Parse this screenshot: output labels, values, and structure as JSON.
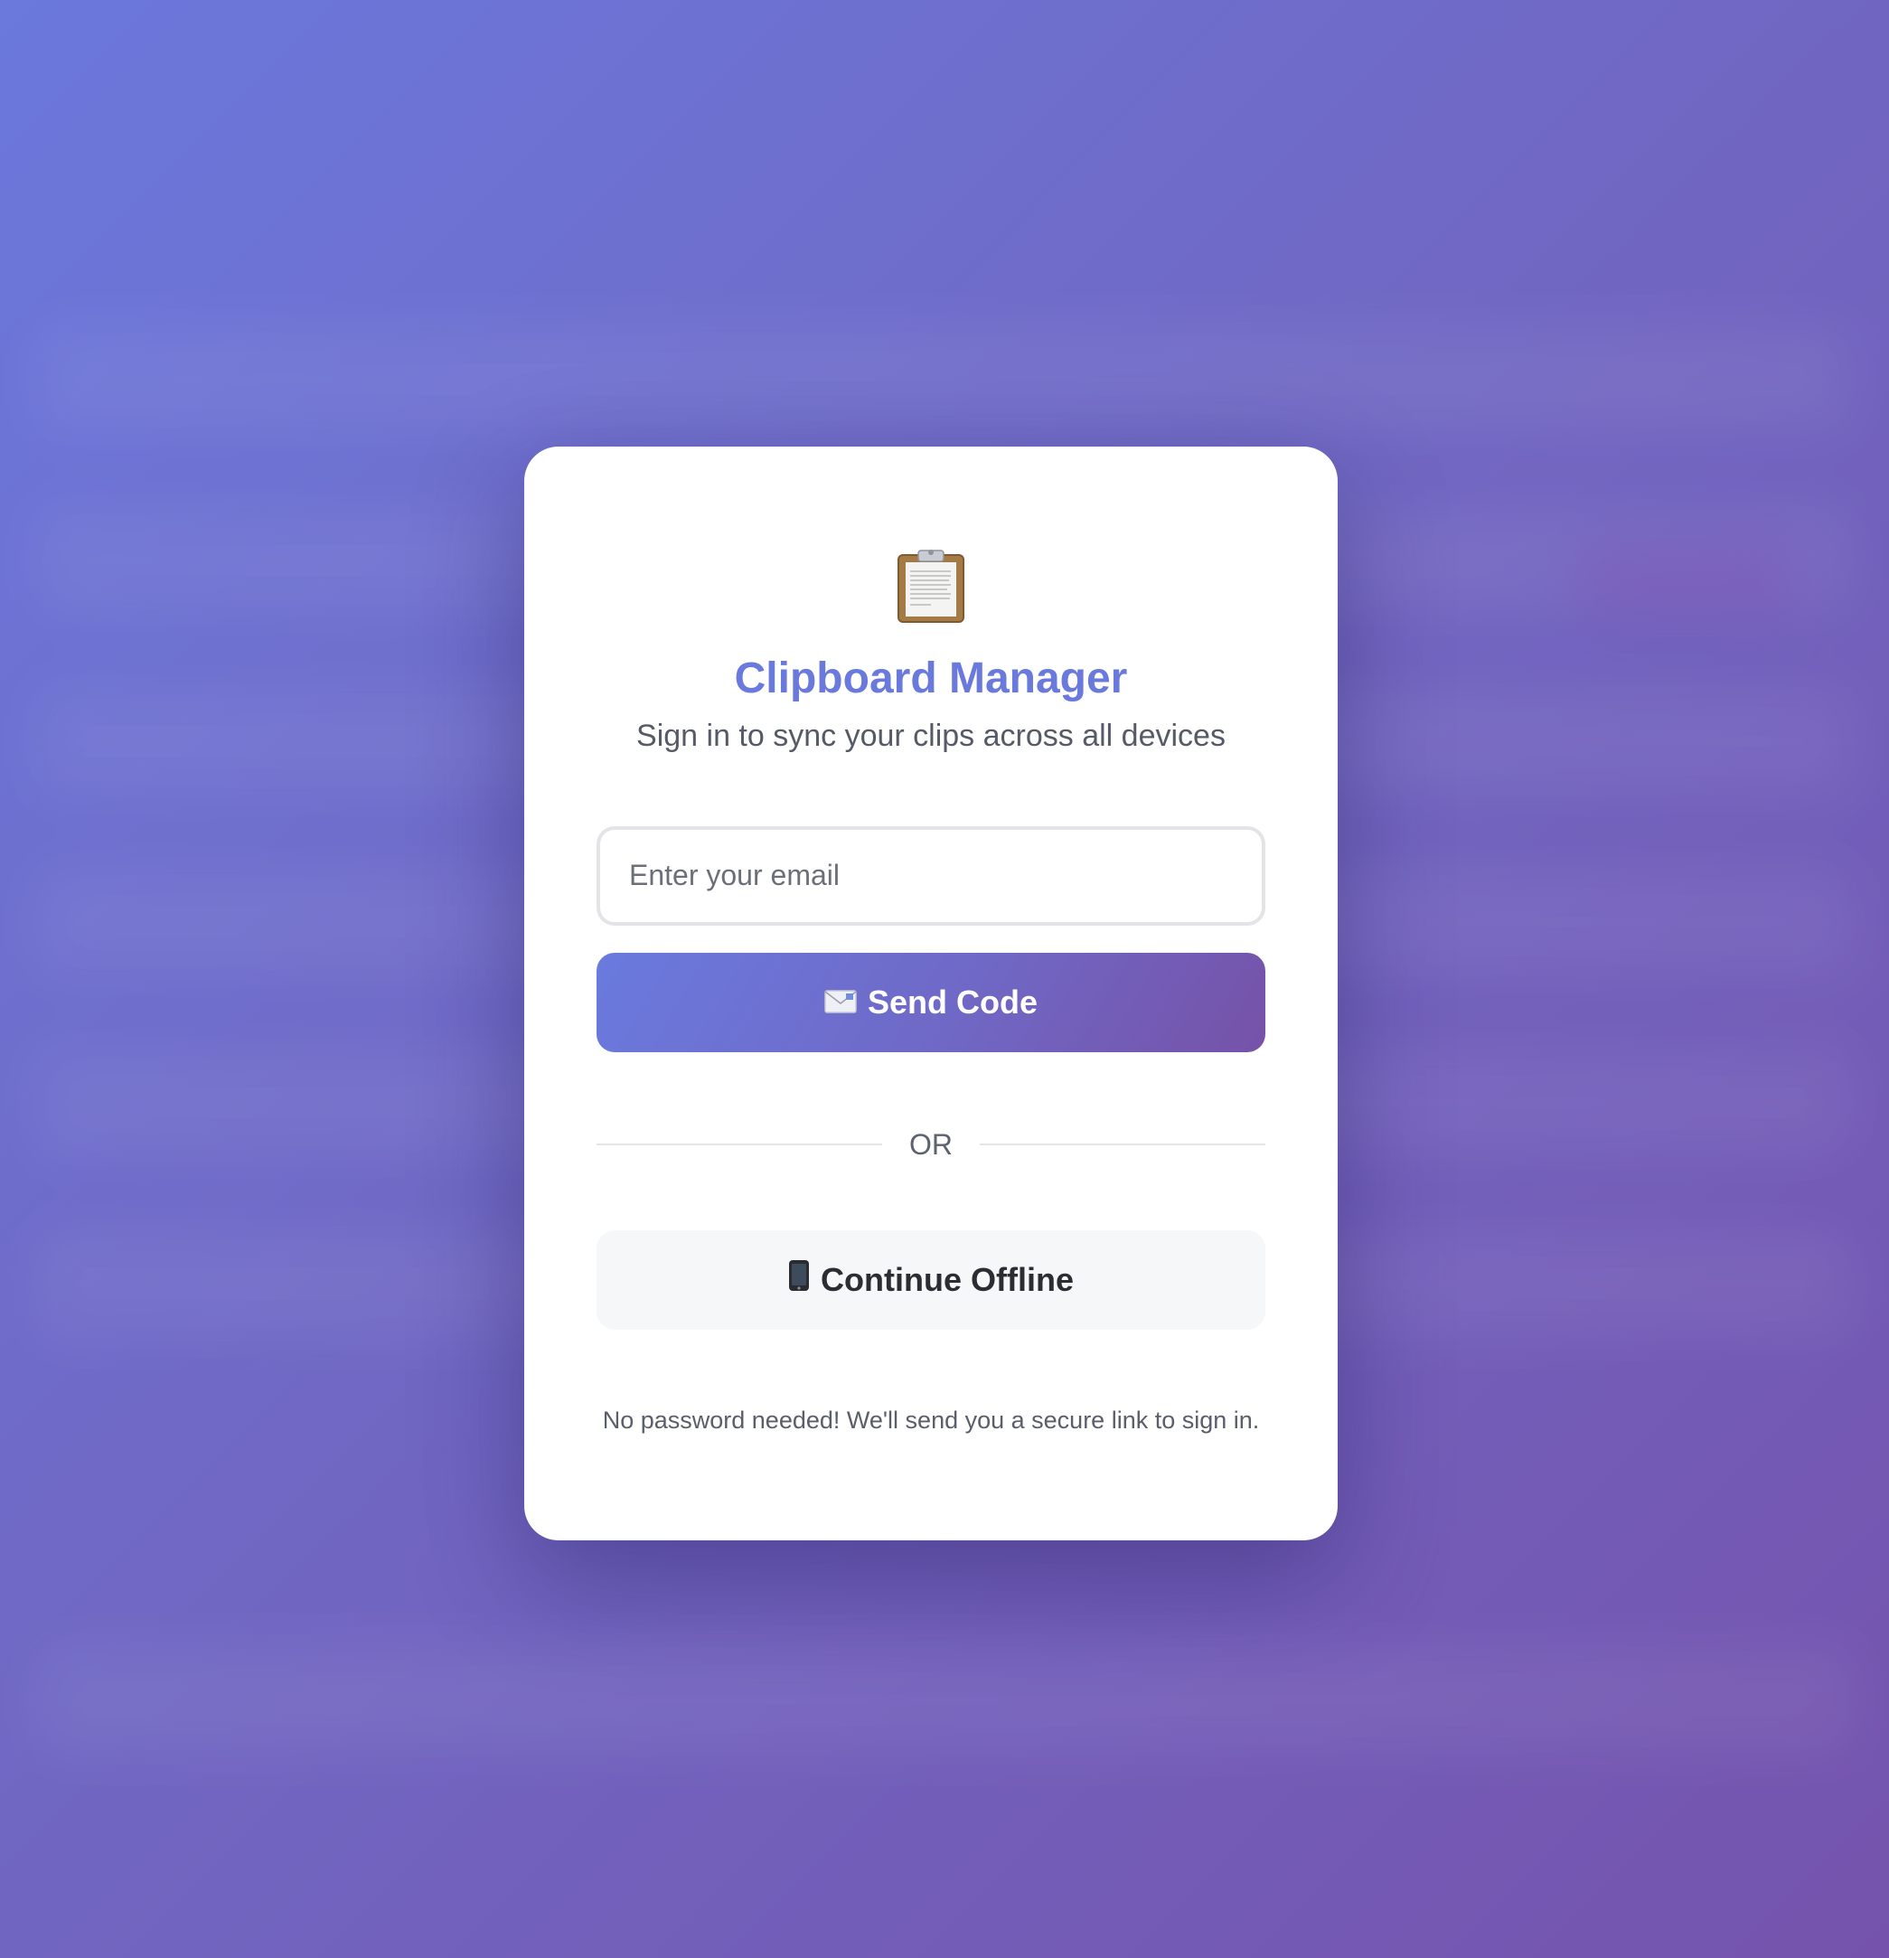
{
  "app": {
    "title": "Clipboard Manager",
    "subtitle": "Sign in to sync your clips across all devices",
    "logo_icon": "clipboard-icon"
  },
  "form": {
    "email_placeholder": "Enter your email",
    "email_value": "",
    "send_button": {
      "icon": "envelope-icon",
      "label": "Send Code"
    },
    "divider_text": "OR",
    "offline_button": {
      "icon": "mobile-phone-icon",
      "label": "Continue Offline"
    },
    "footer_note": "No password needed! We'll send you a secure link to sign in."
  },
  "colors": {
    "accent": "#6a79dc",
    "gradient_start": "#6a7ade",
    "gradient_end": "#7652a8",
    "card_bg": "#ffffff",
    "secondary_button_bg": "#f6f7f9"
  }
}
